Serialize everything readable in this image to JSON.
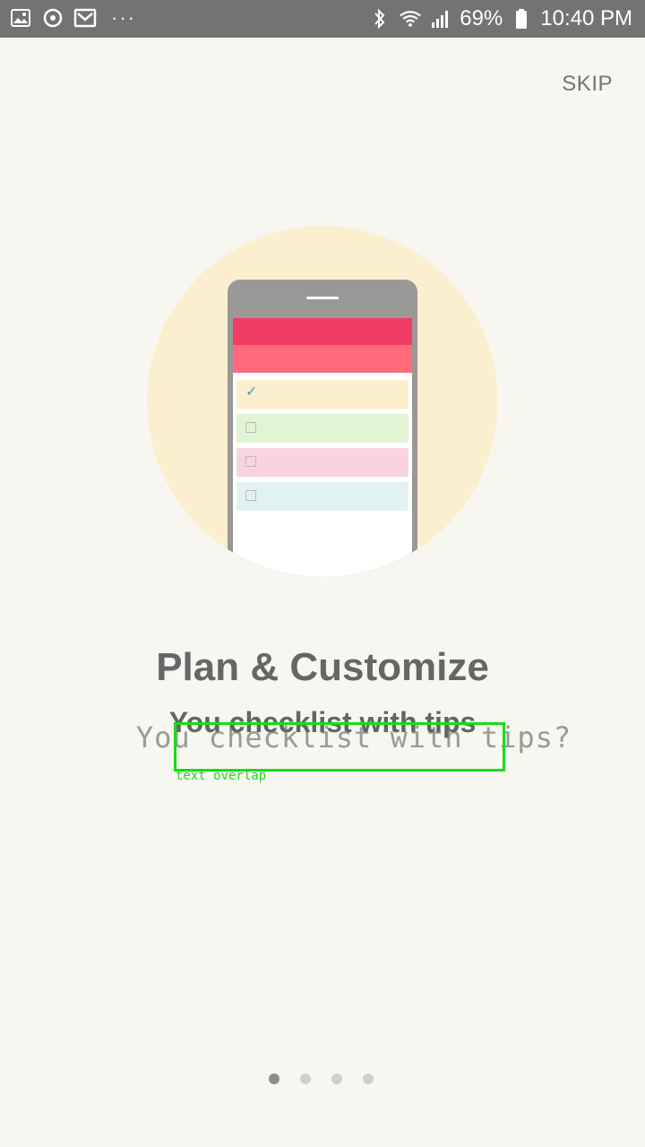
{
  "status_bar": {
    "battery": "69%",
    "time": "10:40 PM",
    "dots": "···",
    "left_icons": [
      "image-icon",
      "sync-icon",
      "mail-icon"
    ],
    "right_icons": [
      "bluetooth-icon",
      "wifi-icon",
      "signal-icon",
      "battery-icon"
    ]
  },
  "skip_label": "SKIP",
  "illustration": {
    "colors": {
      "circle": "#fcefd0",
      "phone": "#9a9896",
      "header_top": "#ef3d63",
      "header_bottom": "#ff6b7d",
      "rows": [
        "#fcefd0",
        "#e2f5d3",
        "#f9d4de",
        "#e2f2f2"
      ]
    },
    "rows_checked": [
      true,
      false,
      false,
      false
    ]
  },
  "title": "Plan & Customize",
  "subtitle": "You checklist with tips",
  "subtitle_overlap": "You checklist with tips?",
  "overlap_label": "text overlap",
  "pager": {
    "count": 4,
    "active": 1
  }
}
